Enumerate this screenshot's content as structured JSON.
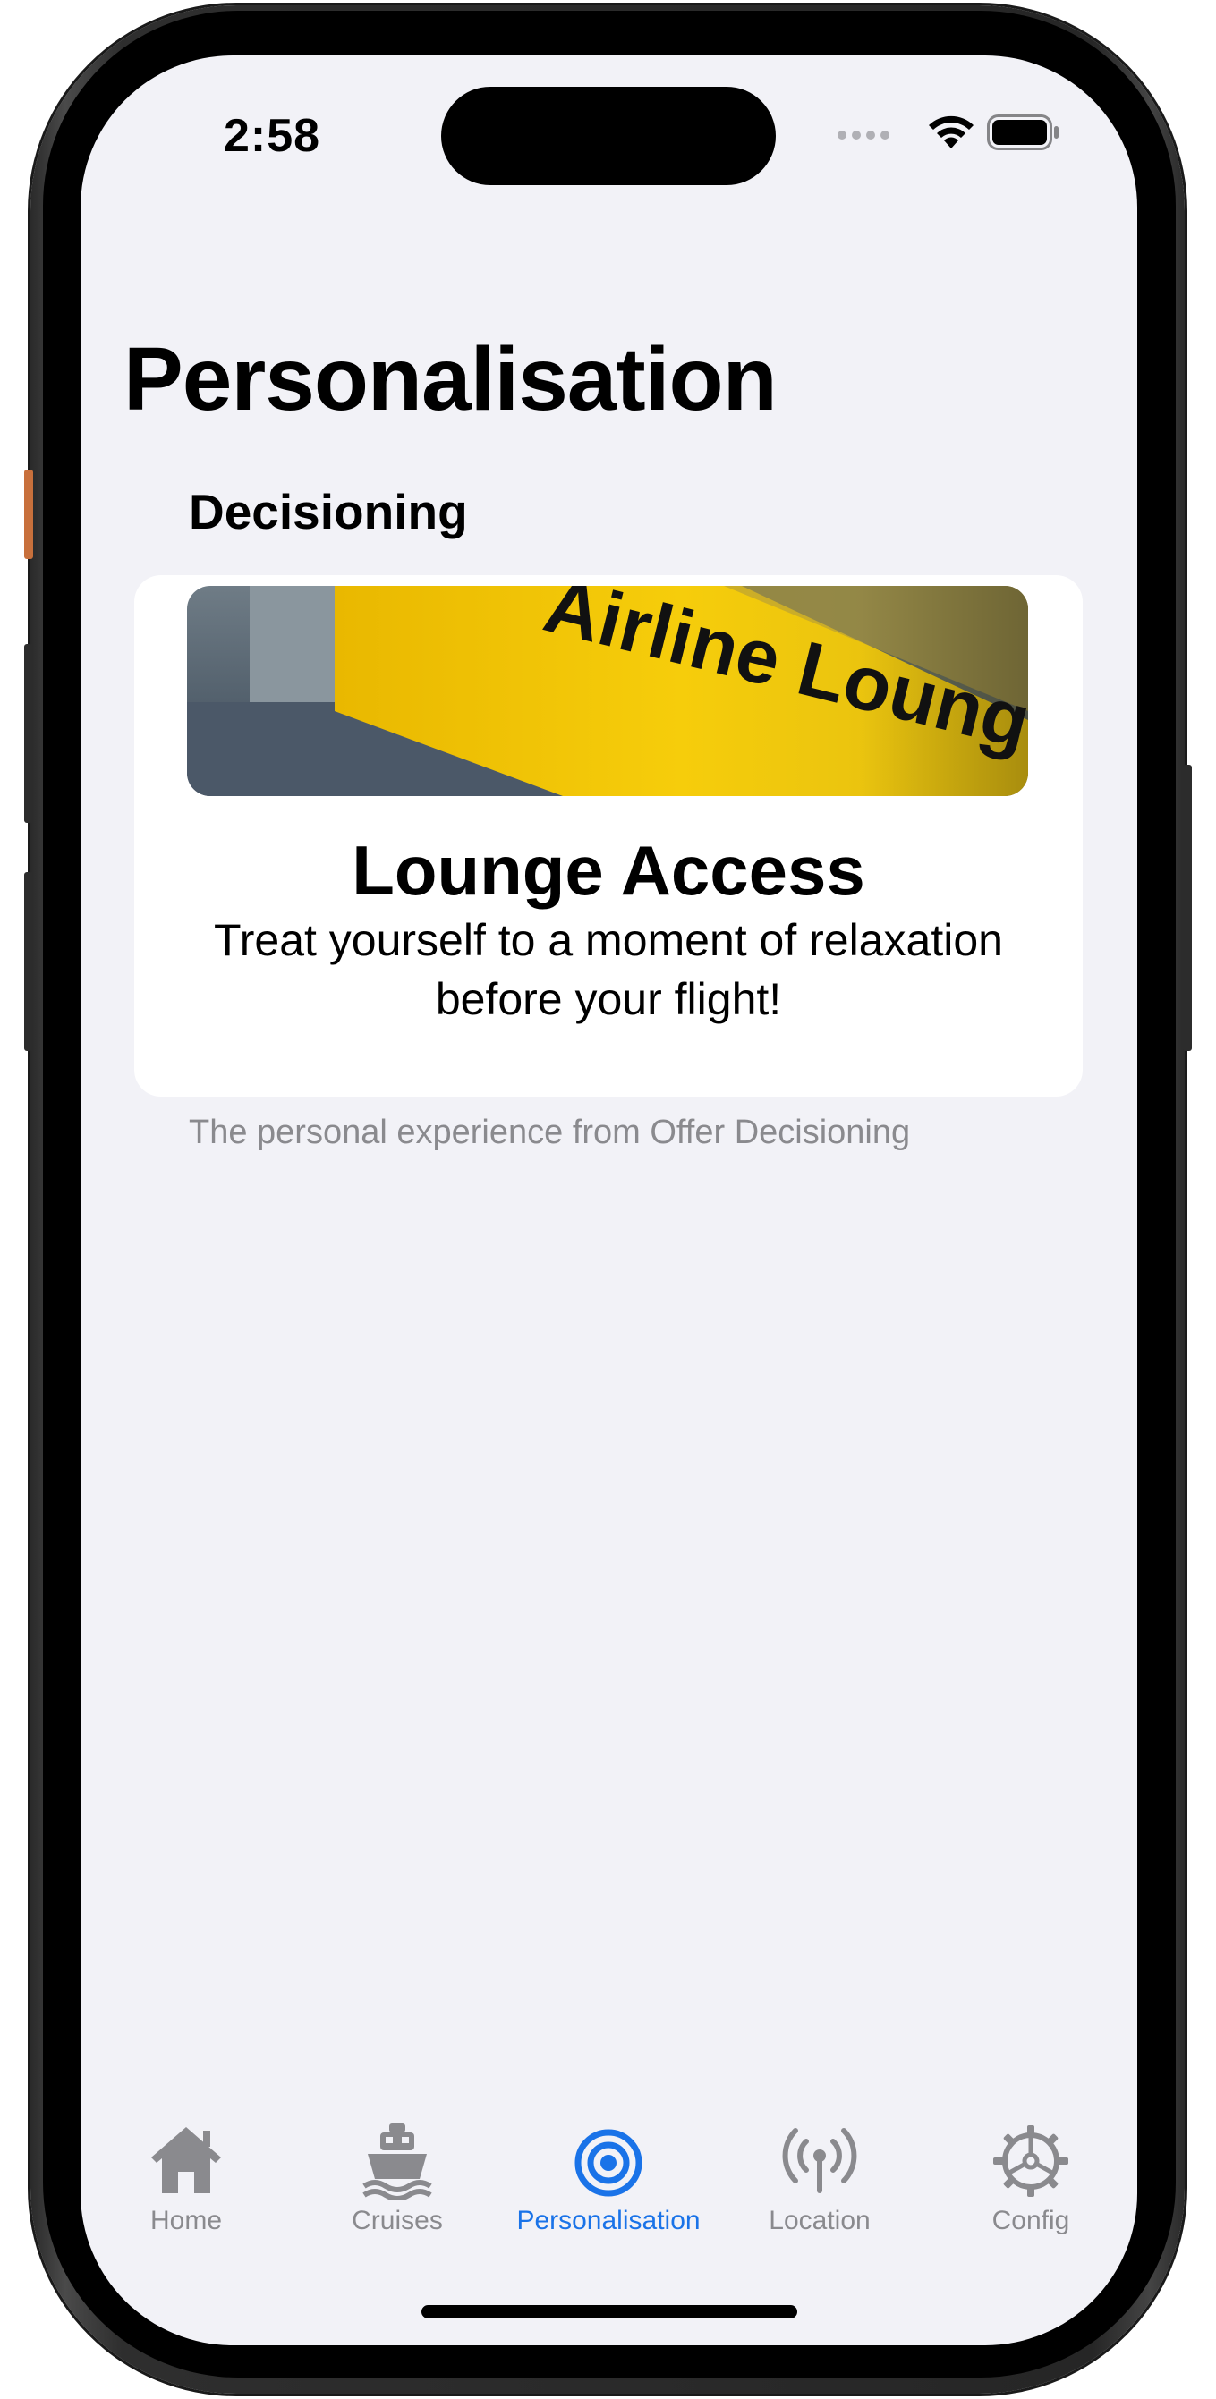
{
  "status_bar": {
    "time": "2:58"
  },
  "page": {
    "title": "Personalisation"
  },
  "decisioning": {
    "section_header": "Decisioning",
    "offer": {
      "image_sign_text": "Airline Lounges",
      "title": "Lounge Access",
      "description": "Treat yourself to a moment of relaxation before your flight!"
    },
    "footer": "The personal experience from Offer Decisioning"
  },
  "tab_bar": {
    "tabs": [
      {
        "label": "Home",
        "icon": "house-icon",
        "active": false
      },
      {
        "label": "Cruises",
        "icon": "ferry-icon",
        "active": false
      },
      {
        "label": "Personalisation",
        "icon": "target-icon",
        "active": true
      },
      {
        "label": "Location",
        "icon": "antenna-radiowaves-icon",
        "active": false
      },
      {
        "label": "Config",
        "icon": "gear-icon",
        "active": false
      }
    ]
  },
  "colors": {
    "accent": "#1a73e8",
    "inactive": "#8a8a8e",
    "background": "#f2f2f7",
    "sign_yellow": "#f4c90a"
  }
}
